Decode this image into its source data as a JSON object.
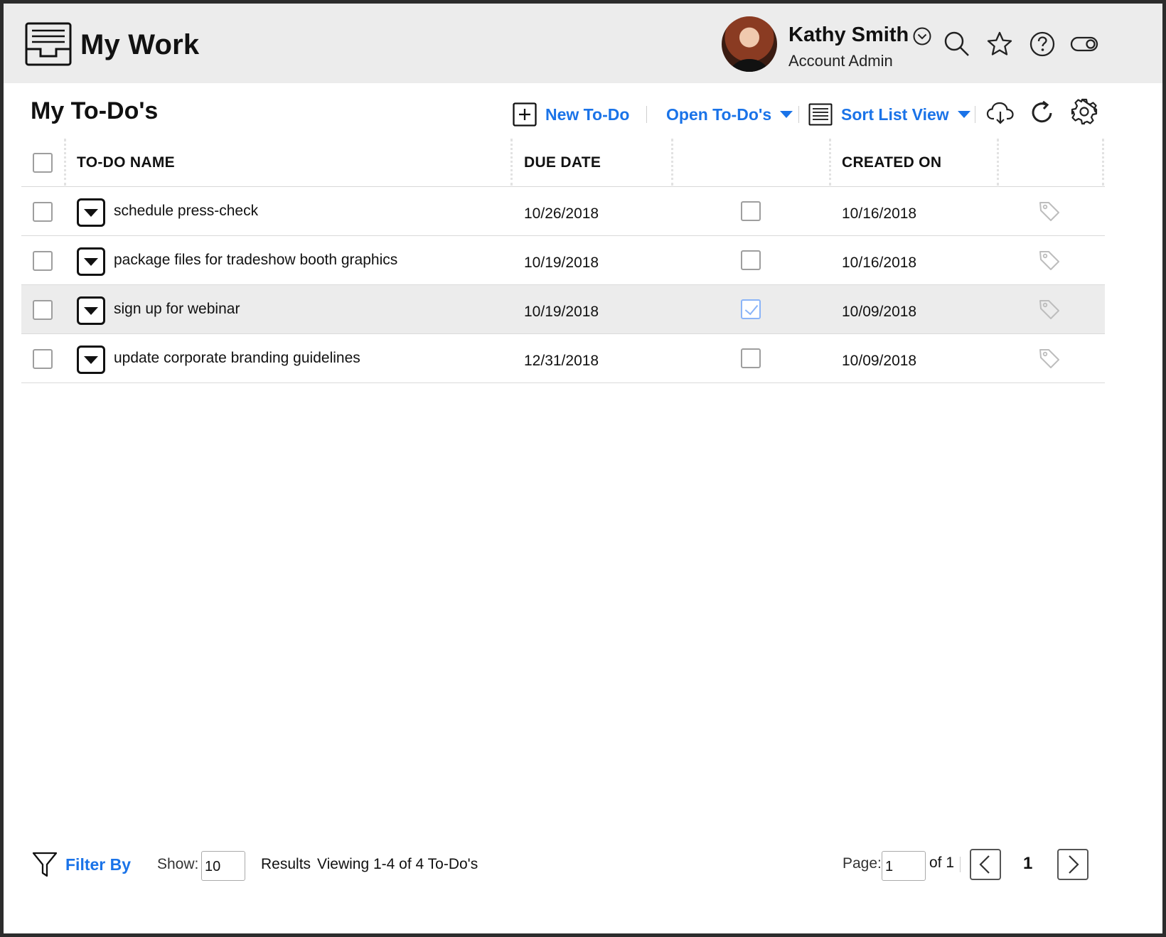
{
  "header": {
    "app_title": "My Work",
    "user_name": "Kathy Smith",
    "user_role": "Account Admin"
  },
  "toolbar": {
    "page_title": "My To-Do's",
    "new_todo_label": "New To-Do",
    "filter_dropdown_label": "Open To-Do's",
    "sort_label": "Sort List View"
  },
  "table": {
    "headers": {
      "name": "TO-DO NAME",
      "due_date": "DUE DATE",
      "complete": "",
      "created_on": "CREATED ON"
    },
    "rows": [
      {
        "name": "schedule press-check",
        "due_date": "10/26/2018",
        "completed": false,
        "created_on": "10/16/2018",
        "highlighted": false
      },
      {
        "name": "package files for tradeshow booth graphics",
        "due_date": "10/19/2018",
        "completed": false,
        "created_on": "10/16/2018",
        "highlighted": false
      },
      {
        "name": "sign up for webinar",
        "due_date": "10/19/2018",
        "completed": true,
        "created_on": "10/09/2018",
        "highlighted": true
      },
      {
        "name": "update corporate branding guidelines",
        "due_date": "12/31/2018",
        "completed": false,
        "created_on": "10/09/2018",
        "highlighted": false
      }
    ]
  },
  "footer": {
    "filter_label": "Filter By",
    "show_label": "Show:",
    "show_value": "10",
    "results_label": "Results",
    "viewing_label": "Viewing 1-4 of 4 To-Do's",
    "page_label": "Page:",
    "page_value": "1",
    "of_label": "of 1",
    "current_page": "1"
  },
  "colors": {
    "accent": "#1a73e8",
    "header_bg": "#ececec",
    "row_highlight": "#ececec"
  },
  "icons": [
    "inbox-tray-icon",
    "chevron-down-circle-icon",
    "search-icon",
    "star-icon",
    "help-icon",
    "toggle-icon",
    "plus-square-icon",
    "list-icon",
    "cloud-download-icon",
    "refresh-icon",
    "gear-icon",
    "tag-icon",
    "filter-icon",
    "chevron-left-icon",
    "chevron-right-icon"
  ]
}
